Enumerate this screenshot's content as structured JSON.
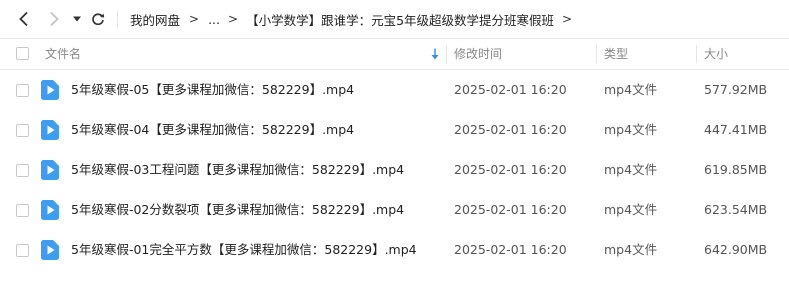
{
  "breadcrumb": {
    "items": [
      "我的网盘",
      "...",
      "【小学数学】跟谁学：元宝5年级超级数学提分班寒假班"
    ]
  },
  "table": {
    "columns": {
      "name": "文件名",
      "modified": "修改时间",
      "type": "类型",
      "size": "大小"
    },
    "rows": [
      {
        "name": "5年级寒假-05【更多课程加微信：582229】.mp4",
        "modified": "2025-02-01 16:20",
        "type": "mp4文件",
        "size": "577.92MB"
      },
      {
        "name": "5年级寒假-04【更多课程加微信：582229】.mp4",
        "modified": "2025-02-01 16:20",
        "type": "mp4文件",
        "size": "447.41MB"
      },
      {
        "name": "5年级寒假-03工程问题【更多课程加微信：582229】.mp4",
        "modified": "2025-02-01 16:20",
        "type": "mp4文件",
        "size": "619.85MB"
      },
      {
        "name": "5年级寒假-02分数裂项【更多课程加微信：582229】.mp4",
        "modified": "2025-02-01 16:20",
        "type": "mp4文件",
        "size": "623.54MB"
      },
      {
        "name": "5年级寒假-01完全平方数【更多课程加微信：582229】.mp4",
        "modified": "2025-02-01 16:20",
        "type": "mp4文件",
        "size": "642.90MB"
      }
    ]
  },
  "icons": {
    "back": "chevron-left-icon",
    "forward": "chevron-right-icon",
    "history": "caret-down-icon",
    "refresh": "refresh-icon",
    "sort": "sort-descending-icon",
    "file": "video-file-icon"
  },
  "colors": {
    "file_icon": "#3e9df0",
    "sort_arrow": "#2f8ff0",
    "disabled_nav": "#c4c4c4"
  }
}
